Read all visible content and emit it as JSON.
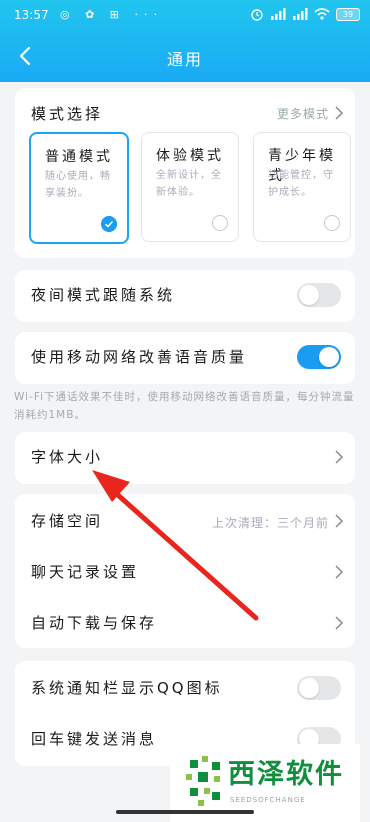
{
  "status": {
    "time": "13:57",
    "left_icons": "◎ ✿ ⊞ ···",
    "battery": "39"
  },
  "header": {
    "title": "通用"
  },
  "mode": {
    "heading": "模式选择",
    "more": "更多模式",
    "cards": [
      {
        "name": "普通模式",
        "desc": "随心使用，畅享装扮。",
        "selected": true
      },
      {
        "name": "体验模式",
        "desc": "全新设计，全新体验。",
        "selected": false
      },
      {
        "name": "青少年模式",
        "desc": "功能管控，守护成长。",
        "selected": false
      }
    ]
  },
  "night": {
    "label": "夜间模式跟随系统",
    "on": false
  },
  "voice": {
    "label": "使用移动网络改善语音质量",
    "on": true
  },
  "tip": "Wi-Fi下通话效果不佳时，使用移动网络改善语音质量，每分钟流量消耗约1MB。",
  "font": {
    "label": "字体大小"
  },
  "storage": {
    "label": "存储空间",
    "sub": "上次清理：三个月前"
  },
  "chat": {
    "label": "聊天记录设置"
  },
  "download": {
    "label": "自动下载与保存"
  },
  "notify": {
    "label": "系统通知栏显示QQ图标",
    "on": false
  },
  "enter": {
    "label": "回车键发送消息",
    "on": false
  },
  "watermark": {
    "text": "西泽软件",
    "sub": "SEEDSOFCHANGE"
  },
  "colors": {
    "accent": "#1a9cf0",
    "arrow": "#e8261e",
    "brand": "#0f8f3c"
  }
}
